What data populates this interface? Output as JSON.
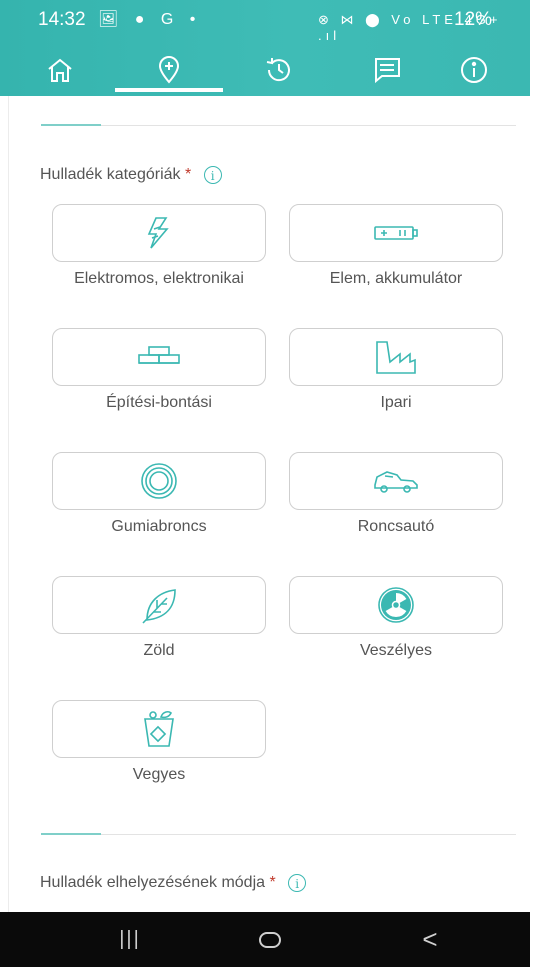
{
  "status_bar": {
    "time": "14:32",
    "left_icons": "🖼 ● G •",
    "right_icons": "⊗ ⋈ ⬤ Vo LTE 4G+ .ıl",
    "battery": "12%"
  },
  "nav": {
    "items": [
      {
        "name": "home",
        "icon": "home-icon"
      },
      {
        "name": "location",
        "icon": "map-pin-icon",
        "active": true
      },
      {
        "name": "history",
        "icon": "history-icon"
      },
      {
        "name": "messages",
        "icon": "message-icon"
      },
      {
        "name": "info",
        "icon": "info-icon"
      }
    ]
  },
  "form": {
    "categories_label": "Hulladék kategóriák",
    "categories_required": "*",
    "categories_info": "i",
    "categories": [
      {
        "label": "Elektromos, elektronikai",
        "icon": "lightning-icon"
      },
      {
        "label": "Elem, akkumulátor",
        "icon": "battery-icon"
      },
      {
        "label": "Építési-bontási",
        "icon": "bricks-icon"
      },
      {
        "label": "Ipari",
        "icon": "factory-icon"
      },
      {
        "label": "Gumiabroncs",
        "icon": "tire-icon"
      },
      {
        "label": "Roncsautó",
        "icon": "wrecked-car-icon"
      },
      {
        "label": "Zöld",
        "icon": "leaf-icon"
      },
      {
        "label": "Veszélyes",
        "icon": "radiation-icon"
      },
      {
        "label": "Vegyes",
        "icon": "mixed-bin-icon"
      }
    ],
    "placement_label": "Hulladék elhelyezésének módja",
    "placement_required": "*",
    "placement_info": "i"
  },
  "colors": {
    "accent": "#3bb8b2",
    "required": "#c0392b",
    "text": "#555555"
  },
  "system_nav": {
    "recents": "|||",
    "home": "○",
    "back": "<"
  }
}
